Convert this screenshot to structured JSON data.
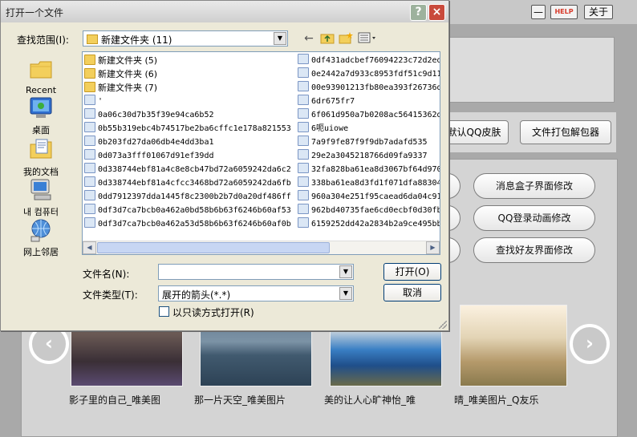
{
  "dialog": {
    "title": "打开一个文件",
    "help_button": "?",
    "close_button": "×",
    "look_in_label": "查找范围(I):",
    "look_in_value": "新建文件夹 (11)",
    "places": [
      {
        "label": "Recent",
        "icon": "recent-folder-icon"
      },
      {
        "label": "桌面",
        "icon": "desktop-icon"
      },
      {
        "label": "我的文档",
        "icon": "my-documents-icon"
      },
      {
        "label": "내 컴퓨터",
        "icon": "my-computer-icon"
      },
      {
        "label": "网上邻居",
        "icon": "network-places-icon"
      }
    ],
    "files_col1": [
      {
        "name": "新建文件夹 (5)",
        "type": "folder"
      },
      {
        "name": "新建文件夹 (6)",
        "type": "folder"
      },
      {
        "name": "新建文件夹 (7)",
        "type": "folder"
      },
      {
        "name": "'",
        "type": "file"
      },
      {
        "name": "0a06c30d7b35f39e94ca6b52",
        "type": "file"
      },
      {
        "name": "0b55b319ebc4b74517be2ba6cffc1e178a821553",
        "type": "file"
      },
      {
        "name": "0b203fd27da06db4e4dd3ba1",
        "type": "file"
      },
      {
        "name": "0d073a3fff01067d91ef39dd",
        "type": "file"
      },
      {
        "name": "0d338744ebf81a4c8e8cb47bd72a6059242da6c2",
        "type": "file"
      },
      {
        "name": "0d338744ebf81a4cfcc3468bd72a6059242da6fb",
        "type": "file"
      },
      {
        "name": "0dd7912397dda1445f8c2300b2b7d0a20df486ff",
        "type": "file"
      },
      {
        "name": "0df3d7ca7bcb0a462a0bd58b6b63f6246b60af53",
        "type": "file"
      },
      {
        "name": "0df3d7ca7bcb0a462a53d58b6b63f6246b60af0b",
        "type": "file"
      }
    ],
    "files_col2": [
      {
        "name": "0df431adcbef76094223c72d2ed",
        "type": "file"
      },
      {
        "name": "0e2442a7d933c8953fdf51c9d11",
        "type": "file"
      },
      {
        "name": "00e93901213fb80ea393f26736d",
        "type": "file"
      },
      {
        "name": "6dr675fr7",
        "type": "file"
      },
      {
        "name": "6f061d950a7b0208ac56415362d",
        "type": "file"
      },
      {
        "name": "6呃uiowe",
        "type": "file"
      },
      {
        "name": "7a9f9fe87f9f9db7adafd535",
        "type": "file"
      },
      {
        "name": "29e2a3045218766d09fa9337",
        "type": "file"
      },
      {
        "name": "32fa828ba61ea8d3067bf64d970",
        "type": "file"
      },
      {
        "name": "338ba61ea8d3fd1f071dfa88304",
        "type": "file"
      },
      {
        "name": "960a304e251f95caead6da04c91",
        "type": "file"
      },
      {
        "name": "962bd40735fae6cd0ecbf0d30fb",
        "type": "file"
      },
      {
        "name": "6159252dd42a2834b2a9ce495bb",
        "type": "file"
      }
    ],
    "filename_label": "文件名(N):",
    "filename_value": "",
    "filetype_label": "文件类型(T):",
    "filetype_value": "展开的箭头(*.*)",
    "open_button": "打开(O)",
    "cancel_button": "取消",
    "readonly_label": "以只读方式打开(R)"
  },
  "app": {
    "minimize_button": "—",
    "help_button": "HELP",
    "about_button": "关于",
    "skin_button": "默认QQ皮肤",
    "unpack_button": "文件打包解包器",
    "pills": [
      "消息盒子界面修改",
      "QQ登录动画修改",
      "查找好友界面修改"
    ],
    "prev_arrow": "‹",
    "next_arrow": "›",
    "thumbnails": [
      {
        "caption": "影子里的自己_唯美图"
      },
      {
        "caption": "那一片天空_唯美图片"
      },
      {
        "caption": "美的让人心旷神怡_唯"
      },
      {
        "caption": "晴_唯美图片_Q友乐"
      }
    ],
    "colors": {
      "accent_red": "#d83a2a",
      "dialog_bg": "#ece9d8",
      "list_border": "#7f9db9"
    }
  }
}
